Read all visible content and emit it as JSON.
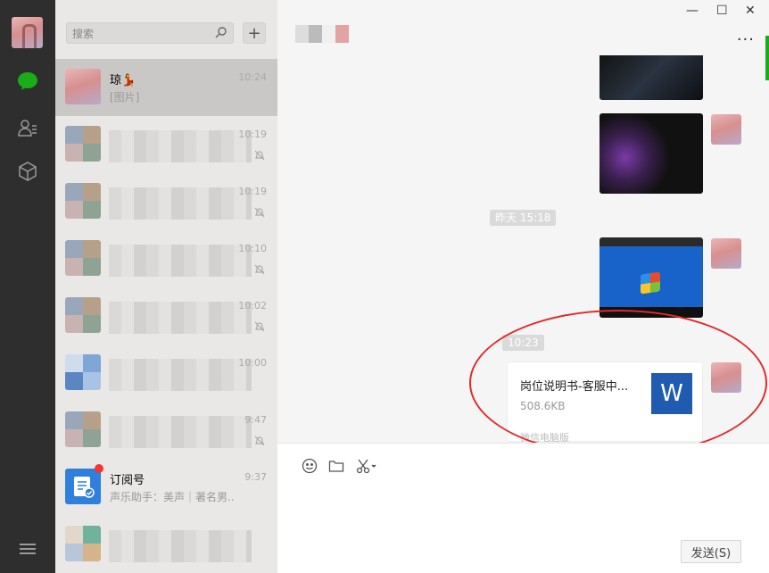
{
  "sidebar": {
    "icons": [
      "chat-icon",
      "contacts-icon",
      "favorites-icon"
    ],
    "accent": "#1aad19"
  },
  "search": {
    "placeholder": "搜索"
  },
  "add_label": "+",
  "conversations": [
    {
      "name": "琼💃",
      "message": "[图片]",
      "time": "10:24",
      "selected": true
    },
    {
      "name": "",
      "message": "",
      "time": "10:19",
      "muted": true
    },
    {
      "name": "",
      "message": "",
      "time": "10:19",
      "muted": true
    },
    {
      "name": "",
      "message": "",
      "time": "10:10",
      "muted": true
    },
    {
      "name": "",
      "message": "",
      "time": "10:02",
      "muted": true
    },
    {
      "name": "",
      "message": "",
      "time": "10:00"
    },
    {
      "name": "",
      "message": "",
      "time": "9:47",
      "muted": true
    },
    {
      "name": "订阅号",
      "message": "声乐助手：美声｜著名男...",
      "time": "9:37",
      "badge": true
    },
    {
      "name": "",
      "message": "",
      "time": ""
    }
  ],
  "chat": {
    "window_buttons": {
      "minimize": "—",
      "maximize": "☐",
      "close": "✕"
    },
    "more_label": "···",
    "stamps": {
      "yesterday": "昨天 15:18",
      "today": "10:23"
    },
    "file": {
      "name": "岗位说明书-客服中...",
      "size": "508.6KB",
      "type_letter": "W",
      "source": "微信电脑版"
    },
    "send_label": "发送(S)"
  }
}
